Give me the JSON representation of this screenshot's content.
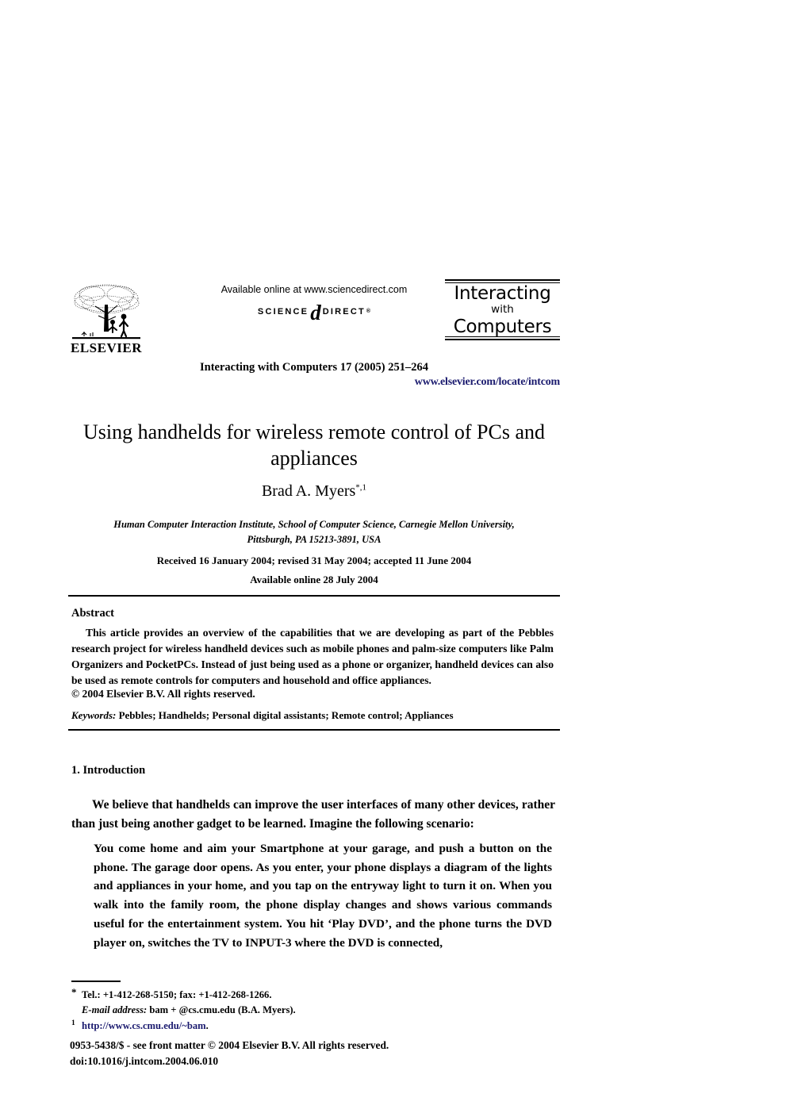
{
  "masthead": {
    "publisher_name": "ELSEVIER",
    "publisher_logo_icon": "elsevier-tree-icon",
    "available_online": "Available online at www.sciencedirect.com",
    "sciencedirect_word1": "SCIENCE",
    "sciencedirect_at": "d",
    "sciencedirect_word2": "DIRECT",
    "sciencedirect_tm": "®",
    "journal_logo_line1": "Interacting",
    "journal_logo_line2": "with",
    "journal_logo_line3": "Computers",
    "journal_citation": "Interacting with Computers 17 (2005) 251–264",
    "journal_url": "www.elsevier.com/locate/intcom",
    "link_color": "#1b1b6f"
  },
  "article": {
    "title": "Using handhelds for wireless remote control of PCs and appliances",
    "author": "Brad A. Myers",
    "author_superscript": "*,1",
    "affiliation_line1": "Human Computer Interaction Institute, School of Computer Science, Carnegie Mellon University,",
    "affiliation_line2": "Pittsburgh, PA 15213-3891, USA",
    "dates": "Received 16 January 2004; revised 31 May 2004; accepted 11 June 2004",
    "available_online": "Available online 28 July 2004"
  },
  "abstract": {
    "heading": "Abstract",
    "body": "This article provides an overview of the capabilities that we are developing as part of the Pebbles research project for wireless handheld devices such as mobile phones and palm-size computers like Palm Organizers and PocketPCs. Instead of just being used as a phone or organizer, handheld devices can also be used as remote controls for computers and household and office appliances.",
    "copyright": "© 2004 Elsevier B.V. All rights reserved.",
    "keywords_label": "Keywords:",
    "keywords_value": " Pebbles; Handhelds; Personal digital assistants; Remote control; Appliances"
  },
  "body": {
    "section_heading": "1. Introduction",
    "paragraph_1": "We believe that handhelds can improve the user interfaces of many other devices, rather than just being another gadget to be learned. Imagine the following scenario:",
    "quote": "You come home and aim your Smartphone at your garage, and push a button on the phone. The garage door opens. As you enter, your phone displays a diagram of the lights and appliances in your home, and you tap on the entryway light to turn it on. When you walk into the family room, the phone display changes and shows various commands useful for the entertainment system. You hit ‘Play DVD’, and the phone turns the DVD player on, switches the TV to INPUT-3 where the DVD is connected,"
  },
  "footnotes": {
    "star_mark": "*",
    "tel_fax": "Tel.: +1-412-268-5150; fax: +1-412-268-1266.",
    "email_label": "E-mail address:",
    "email_value": " bam + @cs.cmu.edu (B.A. Myers).",
    "one_mark": "1",
    "url": "http://www.cs.cmu.edu/~bam",
    "url_period": "."
  },
  "colophon": {
    "issn_line": "0953-5438/$ - see front matter © 2004 Elsevier B.V. All rights reserved.",
    "doi_line": "doi:10.1016/j.intcom.2004.06.010"
  }
}
